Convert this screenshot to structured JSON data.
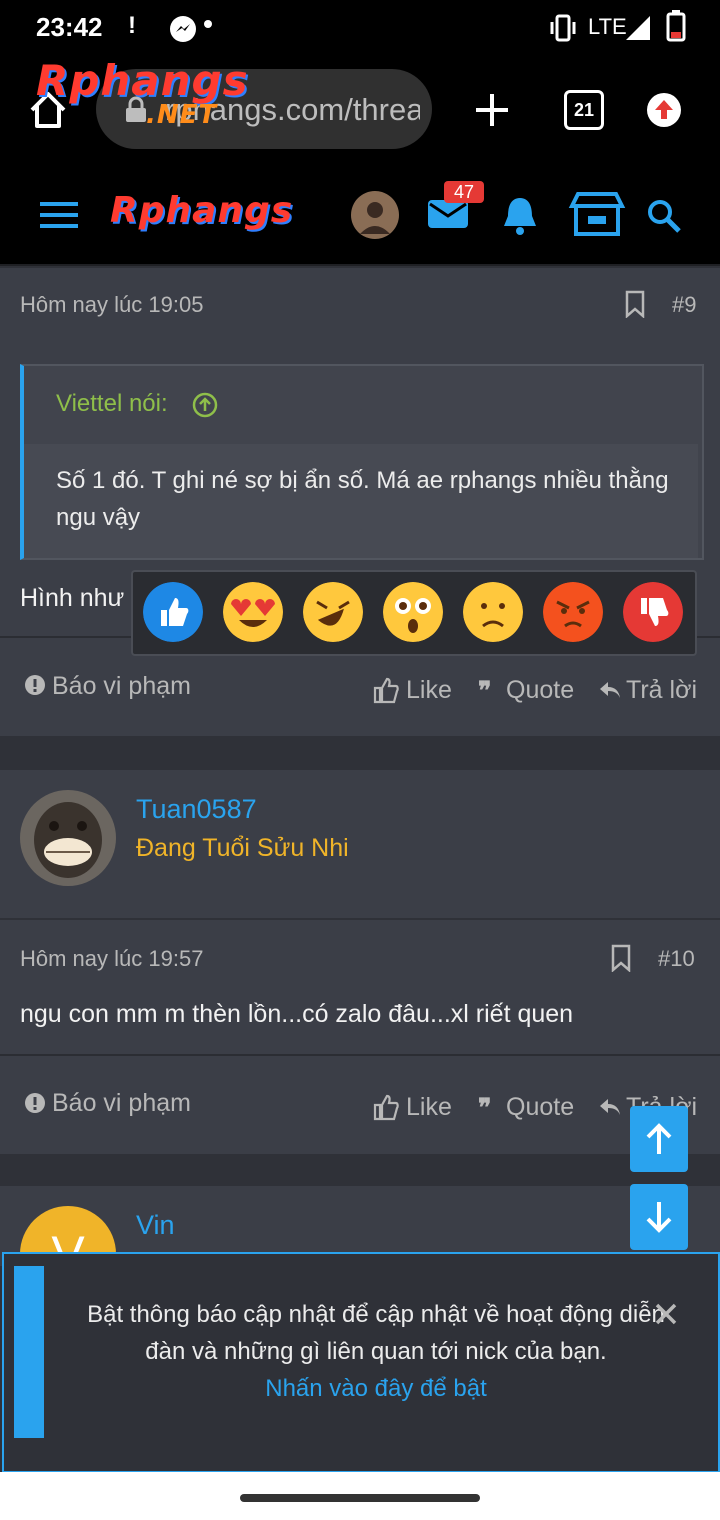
{
  "status_bar": {
    "time": "23:42",
    "network": "LTE"
  },
  "browser": {
    "url": "rphangs.com/threads",
    "tab_count": "21",
    "brand_logo": "Rphangs",
    "brand_sub": ".NET"
  },
  "site_header": {
    "logo": "Rphangs",
    "inbox_badge": "47"
  },
  "post9": {
    "timestamp": "Hôm nay lúc 19:05",
    "number": "#9",
    "quote_author": "Viettel nói:",
    "quote_text": "Số 1 đó. T ghi né sợ bị ẩn số. Má ae rphangs nhiều thằng ngu vậy",
    "body": "Hình như",
    "report": "Báo vi phạm",
    "like": "Like",
    "quote": "Quote",
    "reply": "Trả lời"
  },
  "post10": {
    "username": "Tuan0587",
    "user_title": "Đang Tuổi Sửu Nhi",
    "timestamp": "Hôm nay lúc 19:57",
    "number": "#10",
    "body": "ngu con mm m thèn lồn...có zalo đâu...xl riết quen",
    "report": "Báo vi phạm",
    "like": "Like",
    "quote": "Quote",
    "reply": "Trả lời"
  },
  "post11": {
    "username": "Vin",
    "avatar_letter": "V"
  },
  "reactions": [
    "like-icon",
    "heart-eyes-icon",
    "laughing-icon",
    "surprised-icon",
    "sad-icon",
    "angry-icon",
    "dislike-icon"
  ],
  "notice": {
    "text": "Bật thông báo cập nhật để cập nhật về hoạt động diễn đàn và những gì liên quan tới nick của bạn.",
    "link": "Nhấn vào đây để bật"
  },
  "colors": {
    "accent": "#2aa3ee",
    "card": "#3b3e47",
    "quote_author": "#8fbf4a",
    "user_title": "#f0b429"
  }
}
